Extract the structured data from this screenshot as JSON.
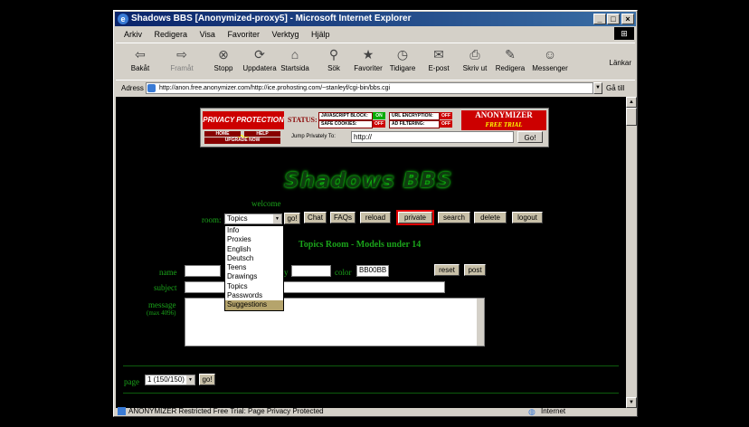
{
  "window": {
    "title": "Shadows BBS [Anonymized-proxy5] - Microsoft Internet Explorer"
  },
  "menu": [
    "Arkiv",
    "Redigera",
    "Visa",
    "Favoriter",
    "Verktyg",
    "Hjälp"
  ],
  "toolbar": [
    {
      "label": "Bakåt",
      "icon": "back-icon",
      "glyph": "⇦"
    },
    {
      "label": "Framåt",
      "icon": "forward-icon",
      "glyph": "⇨"
    },
    {
      "label": "Stopp",
      "icon": "stop-icon",
      "glyph": "⊗"
    },
    {
      "label": "Uppdatera",
      "icon": "refresh-icon",
      "glyph": "⟳"
    },
    {
      "label": "Startsida",
      "icon": "home-icon",
      "glyph": "⌂"
    },
    {
      "label": "Sök",
      "icon": "search-icon",
      "glyph": "⚲"
    },
    {
      "label": "Favoriter",
      "icon": "favorites-icon",
      "glyph": "★"
    },
    {
      "label": "Tidigare",
      "icon": "history-icon",
      "glyph": "◷"
    },
    {
      "label": "E-post",
      "icon": "mail-icon",
      "glyph": "✉"
    },
    {
      "label": "Skriv ut",
      "icon": "print-icon",
      "glyph": "⎙"
    },
    {
      "label": "Redigera",
      "icon": "edit-icon",
      "glyph": "✎"
    },
    {
      "label": "Messenger",
      "icon": "messenger-icon",
      "glyph": "☺"
    }
  ],
  "links_label": "Länkar",
  "address": {
    "label": "Adress",
    "url": "http://anon.free.anonymizer.com/http://ice.prohosting.com/~stanleyf/cgi-bin/bbs.cgi",
    "go_label": "Gå till"
  },
  "banner": {
    "privacy_text": "PRIVACY PROTECTION",
    "privacy_state": "ON",
    "status_label": "STATUS:",
    "js_block": "JAVASCRIPT BLOCK:",
    "js_state": "ON",
    "url_enc": "URL ENCRYPTION:",
    "url_state": "OFF",
    "safe_cookies": "SAFE COOKIES:",
    "cookies_state": "OFF",
    "ad_filter": "AD FILTERING:",
    "ad_state": "OFF",
    "brand": "ANONYMIZER",
    "brand_sub": "FREE TRIAL",
    "home": "HOME",
    "help": "HELP",
    "upgrade": "UPGRADE NOW",
    "jump_label": "Jump Privately To:",
    "jump_value": "http://",
    "jump_go": "Go!"
  },
  "bbs": {
    "logo": "Shadows BBS",
    "welcome": "welcome",
    "room_label": "room:",
    "room_selected": "Topics",
    "go_label": "go!",
    "nav": [
      "Chat",
      "FAQs",
      "reload",
      "private",
      "search",
      "delete",
      "logout"
    ],
    "room_options": [
      "Info",
      "Proxies",
      "English",
      "Deutsch",
      "Teens",
      "Drawings",
      "Topics",
      "Passwords",
      "Suggestions"
    ],
    "room_title": "Topics Room - Models under 14",
    "name_label": "name",
    "email_suffix": "y",
    "color_label": "color",
    "color_value": "BB00BB",
    "reset_label": "reset",
    "post_label": "post",
    "subject_label": "subject",
    "message_label": "message",
    "message_max": "(max 4096)",
    "page_label": "page",
    "page_value": "1 (150/150)",
    "page_go": "go!"
  },
  "status": {
    "text": "ANONYMIZER Restricted Free Trial: Page Privacy Protected",
    "zone": "Internet"
  }
}
